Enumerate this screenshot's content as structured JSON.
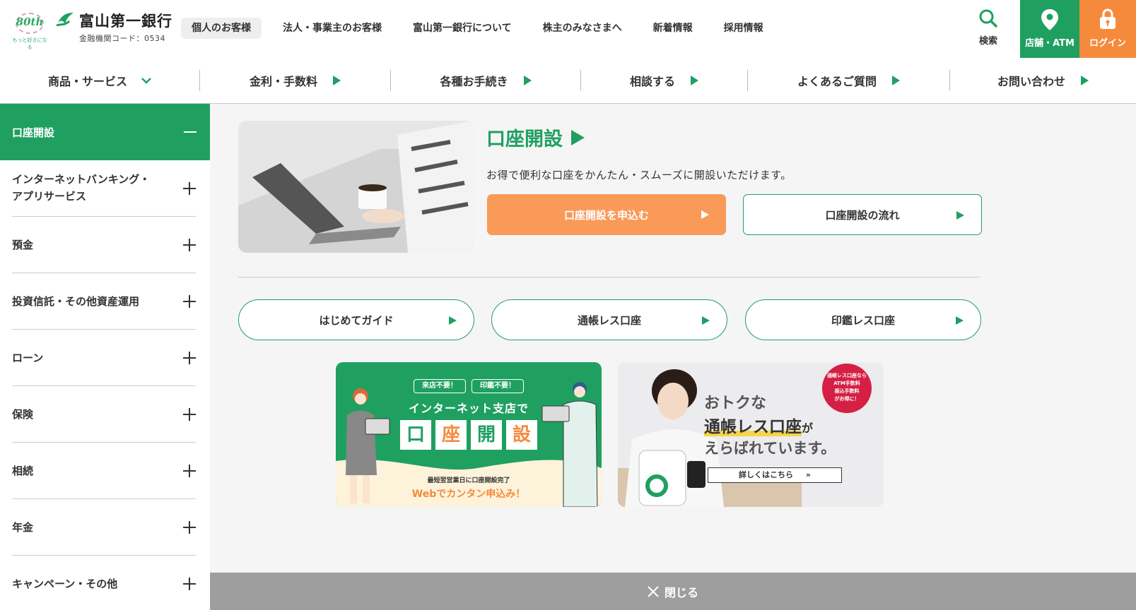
{
  "header": {
    "anniversary_logo": {
      "number": "80th",
      "tagline": "もっと好きになる"
    },
    "bank_name": "富山第一銀行",
    "bank_code": "金融機関コード：0534",
    "top_nav": [
      {
        "label": "個人のお客様",
        "active": true
      },
      {
        "label": "法人・事業主のお客様",
        "active": false
      },
      {
        "label": "富山第一銀行について",
        "active": false
      },
      {
        "label": "株主のみなさまへ",
        "active": false
      },
      {
        "label": "新着情報",
        "active": false
      },
      {
        "label": "採用情報",
        "active": false
      }
    ],
    "search_label": "検索",
    "atm_label": "店舗・ATM",
    "login_label": "ログイン",
    "colors": {
      "green": "#1fa060",
      "orange": "#f68a3c"
    }
  },
  "category_nav": [
    {
      "label": "商品・サービス",
      "indicator": "chevron-down"
    },
    {
      "label": "金利・手数料",
      "indicator": "triangle-right"
    },
    {
      "label": "各種お手続き",
      "indicator": "triangle-right"
    },
    {
      "label": "相談する",
      "indicator": "triangle-right"
    },
    {
      "label": "よくあるご質問",
      "indicator": "triangle-right"
    },
    {
      "label": "お問い合わせ",
      "indicator": "triangle-right"
    }
  ],
  "sidebar": {
    "active_item": "口座開設",
    "items": [
      {
        "label": "インターネットバンキング・\nアプリサービス"
      },
      {
        "label": "預金"
      },
      {
        "label": "投資信託・その他資産運用"
      },
      {
        "label": "ローン"
      },
      {
        "label": "保険"
      },
      {
        "label": "相続"
      },
      {
        "label": "年金"
      },
      {
        "label": "キャンペーン・その他"
      }
    ]
  },
  "main": {
    "title": "口座開設",
    "description": "お得で便利な口座をかんたん・スムーズに開設いただけます。",
    "apply_button": "口座開設を申込む",
    "flow_button": "口座開設の流れ",
    "pill_buttons": [
      {
        "label": "はじめてガイド"
      },
      {
        "label": "通帳レス口座"
      },
      {
        "label": "印鑑レス口座"
      }
    ],
    "banner1": {
      "tag1": "来店不要！",
      "tag2": "印鑑不要！",
      "headline": "インターネット支店で",
      "big_chars": [
        "口",
        "座",
        "開",
        "設"
      ],
      "note": "最短翌営業日に口座開設完了",
      "cta": "Webでカンタン申込み！"
    },
    "banner2": {
      "line1": "おトクな",
      "line2a": "通帳レス口座",
      "line2b": "が",
      "line3": "えらばれています。",
      "badge": [
        "通帳レス口座なら",
        "ATM手数料",
        "振込手数料",
        "がお得に！"
      ],
      "cta": "詳しくはこちら"
    }
  },
  "close_bar": {
    "label": "閉じる"
  }
}
